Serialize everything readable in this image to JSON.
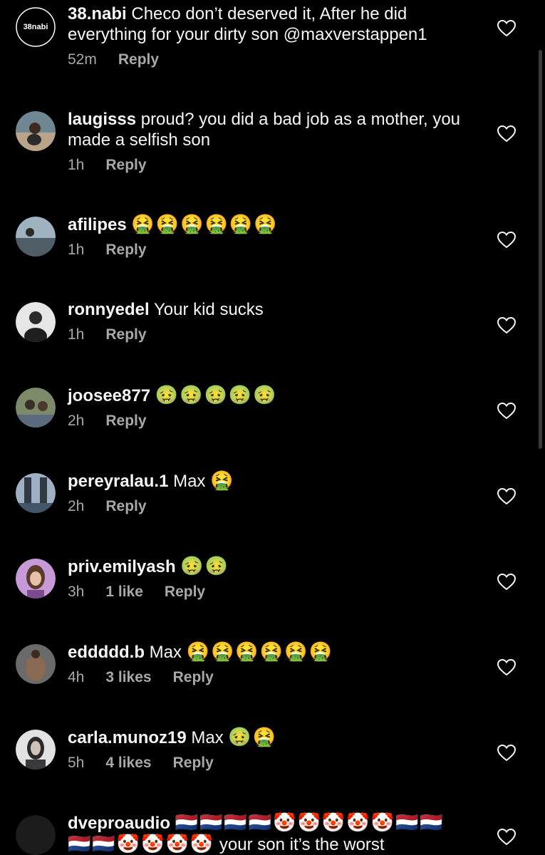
{
  "comments": [
    {
      "user": "38.nabi",
      "text": "Checo don’t deserved it, After he did everything for your dirty son @maxverstappen1",
      "emoji": "",
      "time": "52m",
      "likes": "",
      "reply": "Reply",
      "avatar_text": "38nabi",
      "avatar_color": "#000000"
    },
    {
      "user": "laugisss",
      "text": "proud? you did a bad job as a mother, you made a selfish son",
      "emoji": "",
      "time": "1h",
      "likes": "",
      "reply": "Reply",
      "avatar_color": "#7a8a93"
    },
    {
      "user": "afilipes",
      "text": "",
      "emoji": "🤮🤮🤮🤮🤮🤮",
      "time": "1h",
      "likes": "",
      "reply": "Reply",
      "avatar_color": "#8a9ca6"
    },
    {
      "user": "ronnyedel",
      "text": "Your kid sucks",
      "emoji": "",
      "time": "1h",
      "likes": "",
      "reply": "Reply",
      "avatar_color": "#cfcfcf"
    },
    {
      "user": "joosee877",
      "text": "",
      "emoji": "🤢🤢🤢🤢🤢",
      "time": "2h",
      "likes": "",
      "reply": "Reply",
      "avatar_color": "#6f7d5e"
    },
    {
      "user": "pereyralau.1",
      "text": "Max",
      "emoji": "🤮",
      "time": "2h",
      "likes": "",
      "reply": "Reply",
      "avatar_color": "#5d6b7a"
    },
    {
      "user": "priv.emilyash",
      "text": "",
      "emoji": "🤢🤢",
      "time": "3h",
      "likes": "1 like",
      "reply": "Reply",
      "avatar_color": "#b58cc4"
    },
    {
      "user": "eddddd.b",
      "text": "Max",
      "emoji": "🤮🤮🤮🤮🤮🤮",
      "time": "4h",
      "likes": "3 likes",
      "reply": "Reply",
      "avatar_color": "#6b6b6b"
    },
    {
      "user": "carla.munoz19",
      "text": "Max",
      "emoji": "🤢🤮",
      "time": "5h",
      "likes": "4 likes",
      "reply": "Reply",
      "avatar_color": "#d9d9d9"
    },
    {
      "user": "dvepro​audio",
      "text": "your son it’s the worst",
      "emoji_line1": "🇳🇱🇳🇱🇳🇱🇳🇱🤡🤡🤡🤡🤡🇳🇱🇳🇱",
      "emoji_line2": "🇳🇱🇳🇱🤡🤡🤡🤡",
      "time": "",
      "likes": "",
      "reply": "",
      "avatar_color": "#1c1c1c"
    }
  ],
  "icons": {
    "like": "heart-outline-icon"
  }
}
